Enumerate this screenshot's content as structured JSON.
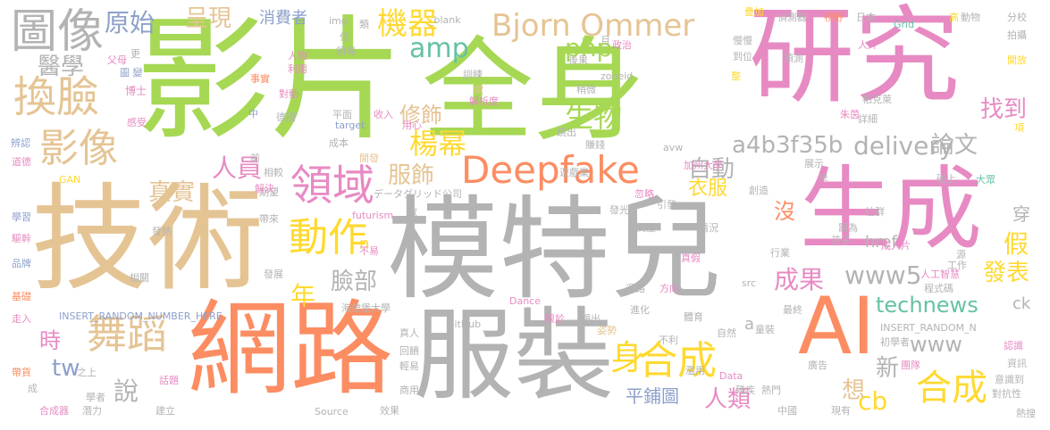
{
  "words": [
    {
      "text": "影片",
      "color": "#a6d854"
    },
    {
      "text": "全身",
      "color": "#a6d854"
    },
    {
      "text": "研究",
      "color": "#e78ac3"
    },
    {
      "text": "模特兒",
      "color": "#b3b3b3"
    },
    {
      "text": "技術",
      "color": "#e5c494"
    },
    {
      "text": "網路",
      "color": "#fc8d62"
    },
    {
      "text": "服裝",
      "color": "#b3b3b3"
    },
    {
      "text": "生成",
      "color": "#e78ac3"
    },
    {
      "text": "AI",
      "color": "#fc8d62"
    },
    {
      "text": "Deepfake",
      "color": "#fc8d62"
    },
    {
      "text": "Bjorn Ommer",
      "color": "#e5c494"
    },
    {
      "text": "圖像",
      "color": "#b3b3b3"
    },
    {
      "text": "換臉",
      "color": "#e5c494"
    },
    {
      "text": "影像",
      "color": "#e5c494"
    },
    {
      "text": "舞蹈",
      "color": "#e5c494"
    },
    {
      "text": "領域",
      "color": "#e78ac3"
    },
    {
      "text": "動作",
      "color": "#ffd92f"
    },
    {
      "text": "合成",
      "color": "#ffd92f"
    },
    {
      "text": "身",
      "color": "#ffd92f"
    },
    {
      "text": "合成",
      "color": "#ffd92f"
    },
    {
      "text": "technews",
      "color": "#66c2a5"
    },
    {
      "text": "delivery",
      "color": "#b3b3b3"
    },
    {
      "text": "www5",
      "color": "#b3b3b3"
    },
    {
      "text": "機器",
      "color": "#ffd92f"
    },
    {
      "text": "呈現",
      "color": "#e5c494"
    },
    {
      "text": "原始",
      "color": "#8da0cb"
    },
    {
      "text": "醫學",
      "color": "#b3b3b3"
    },
    {
      "text": "楊幂",
      "color": "#ffd92f"
    },
    {
      "text": "生物",
      "color": "#a6d854"
    },
    {
      "text": "amp",
      "color": "#66c2a5"
    },
    {
      "text": "php",
      "color": "#a6d854"
    },
    {
      "text": "修飾",
      "color": "#e5c494"
    },
    {
      "text": "a4b3f35b",
      "color": "#b3b3b3"
    },
    {
      "text": "自動",
      "color": "#b3b3b3"
    },
    {
      "text": "論文",
      "color": "#b3b3b3"
    },
    {
      "text": "找到",
      "color": "#e78ac3"
    },
    {
      "text": "人員",
      "color": "#e78ac3"
    },
    {
      "text": "真實",
      "color": "#e5c494"
    },
    {
      "text": "服飾",
      "color": "#e5c494"
    },
    {
      "text": "衣服",
      "color": "#ffd92f"
    },
    {
      "text": "成果",
      "color": "#e78ac3"
    },
    {
      "text": "發表",
      "color": "#ffd92f"
    },
    {
      "text": "年",
      "color": "#ffd92f"
    },
    {
      "text": "臉部",
      "color": "#b3b3b3"
    },
    {
      "text": "時",
      "color": "#e78ac3"
    },
    {
      "text": "說",
      "color": "#b3b3b3"
    },
    {
      "text": "人類",
      "color": "#e78ac3"
    },
    {
      "text": "平鋪圖",
      "color": "#8da0cb"
    },
    {
      "text": "cb",
      "color": "#ffd92f"
    },
    {
      "text": "www",
      "color": "#b3b3b3"
    },
    {
      "text": "新",
      "color": "#b3b3b3"
    },
    {
      "text": "想",
      "color": "#e5c494"
    },
    {
      "text": "tw",
      "color": "#8da0cb"
    },
    {
      "text": "消費者",
      "color": "#8da0cb"
    },
    {
      "text": "href",
      "color": "#b3b3b3"
    },
    {
      "text": "沒",
      "color": "#fc8d62"
    },
    {
      "text": "假",
      "color": "#ffd92f"
    },
    {
      "text": "穿",
      "color": "#b3b3b3"
    },
    {
      "text": "ck",
      "color": "#b3b3b3"
    },
    {
      "text": "n",
      "color": "#ffd92f"
    },
    {
      "text": "a",
      "color": "#b3b3b3"
    },
    {
      "text": "img",
      "color": "#b3b3b3"
    },
    {
      "text": "類",
      "color": "#b3b3b3"
    },
    {
      "text": "_blank",
      "color": "#b3b3b3"
    },
    {
      "text": "更",
      "color": "#b3b3b3"
    },
    {
      "text": "父母",
      "color": "#e78ac3"
    },
    {
      "text": "圖 變",
      "color": "#8da0cb"
    },
    {
      "text": "博士",
      "color": "#e78ac3"
    },
    {
      "text": "感受",
      "color": "#e78ac3"
    },
    {
      "text": "辨認",
      "color": "#8da0cb"
    },
    {
      "text": "人物",
      "color": "#e78ac3"
    },
    {
      "text": "利用",
      "color": "#e78ac3"
    },
    {
      "text": "低",
      "color": "#b3b3b3"
    },
    {
      "text": "領導",
      "color": "#b3b3b3"
    },
    {
      "text": "事實",
      "color": "#fc8d62"
    },
    {
      "text": "對動",
      "color": "#e78ac3"
    },
    {
      "text": "平面",
      "color": "#b3b3b3"
    },
    {
      "text": "收入",
      "color": "#e78ac3"
    },
    {
      "text": "解析度",
      "color": "#e78ac3"
    },
    {
      "text": "訓練",
      "color": "#b3b3b3"
    },
    {
      "text": "做",
      "color": "#e5c494"
    },
    {
      "text": "zoneid",
      "color": "#b3b3b3"
    },
    {
      "text": "後果",
      "color": "#b3b3b3"
    },
    {
      "text": "政治",
      "color": "#e78ac3"
    },
    {
      "text": "月",
      "color": "#b3b3b3"
    },
    {
      "text": "稍微",
      "color": "#b3b3b3"
    },
    {
      "text": "跳出",
      "color": "#b3b3b3"
    },
    {
      "text": "賺錢",
      "color": "#b3b3b3"
    },
    {
      "text": "avw",
      "color": "#b3b3b3"
    },
    {
      "text": "加州大學",
      "color": "#e78ac3"
    },
    {
      "text": "疊加",
      "color": "#ffd92f"
    },
    {
      "text": "偵測器",
      "color": "#b3b3b3"
    },
    {
      "text": "視野",
      "color": "#fc8d62"
    },
    {
      "text": "日本",
      "color": "#b3b3b3"
    },
    {
      "text": "Grid",
      "color": "#66c2a5"
    },
    {
      "text": "高",
      "color": "#ffd92f"
    },
    {
      "text": "動物",
      "color": "#b3b3b3"
    },
    {
      "text": "分校",
      "color": "#b3b3b3"
    },
    {
      "text": "拍攝",
      "color": "#b3b3b3"
    },
    {
      "text": "慢慢",
      "color": "#b3b3b3"
    },
    {
      "text": "到位",
      "color": "#b3b3b3"
    },
    {
      "text": "預測",
      "color": "#b3b3b3"
    },
    {
      "text": "人片",
      "color": "#e78ac3"
    },
    {
      "text": "開放",
      "color": "#ffd92f"
    },
    {
      "text": "柏克萊",
      "color": "#b3b3b3"
    },
    {
      "text": "朱茵",
      "color": "#e78ac3"
    },
    {
      "text": "詳細",
      "color": "#b3b3b3"
    },
    {
      "text": "項",
      "color": "#ffd92f"
    },
    {
      "text": "整",
      "color": "#ffd92f"
    },
    {
      "text": "target",
      "color": "#8da0cb"
    },
    {
      "text": "中",
      "color": "#8da0cb"
    },
    {
      "text": "德國",
      "color": "#b3b3b3"
    },
    {
      "text": "成本",
      "color": "#b3b3b3"
    },
    {
      "text": "用心",
      "color": "#e78ac3"
    },
    {
      "text": "前",
      "color": "#b3b3b3"
    },
    {
      "text": "道德",
      "color": "#e78ac3"
    },
    {
      "text": "GAN",
      "color": "#ffd92f"
    },
    {
      "text": "學習",
      "color": "#8da0cb"
    },
    {
      "text": "驅幹",
      "color": "#e78ac3"
    },
    {
      "text": "品牌",
      "color": "#8da0cb"
    },
    {
      "text": "基礎",
      "color": "#fc8d62"
    },
    {
      "text": "走入",
      "color": "#e78ac3"
    },
    {
      "text": "帶貨",
      "color": "#fc8d62"
    },
    {
      "text": "成",
      "color": "#b3b3b3"
    },
    {
      "text": "合成器",
      "color": "#e78ac3"
    },
    {
      "text": "開發",
      "color": "#e5c494"
    },
    {
      "text": "相較",
      "color": "#b3b3b3"
    },
    {
      "text": "期望",
      "color": "#b3b3b3"
    },
    {
      "text": "解決",
      "color": "#e78ac3"
    },
    {
      "text": "データグリッド公司",
      "color": "#b3b3b3"
    },
    {
      "text": "futurism",
      "color": "#e78ac3"
    },
    {
      "text": "帶來",
      "color": "#b3b3b3"
    },
    {
      "text": "發熱",
      "color": "#b3b3b3"
    },
    {
      "text": "發展",
      "color": "#b3b3b3"
    },
    {
      "text": "相關",
      "color": "#b3b3b3"
    },
    {
      "text": "海德堡大學",
      "color": "#b3b3b3"
    },
    {
      "text": "INSERT_RANDOM_NUMBER_HERE",
      "color": "#8da0cb"
    },
    {
      "text": "不易",
      "color": "#e78ac3"
    },
    {
      "text": "教",
      "color": "#b3b3b3"
    },
    {
      "text": "遊戲業",
      "color": "#b3b3b3"
    },
    {
      "text": "忽略",
      "color": "#e78ac3"
    },
    {
      "text": "發光",
      "color": "#b3b3b3"
    },
    {
      "text": "引發",
      "color": "#b3b3b3"
    },
    {
      "text": "創造",
      "color": "#b3b3b3"
    },
    {
      "text": "展示",
      "color": "#b3b3b3"
    },
    {
      "text": "早",
      "color": "#b3b3b3"
    },
    {
      "text": "碰上",
      "color": "#b3b3b3"
    },
    {
      "text": "大眾",
      "color": "#66c2a5"
    },
    {
      "text": "社群",
      "color": "#b3b3b3"
    },
    {
      "text": "題為",
      "color": "#b3b3b3"
    },
    {
      "text": "情況",
      "color": "#b3b3b3"
    },
    {
      "text": "高度",
      "color": "#b3b3b3"
    },
    {
      "text": "孩子",
      "color": "#b3b3b3"
    },
    {
      "text": "真假",
      "color": "#e78ac3"
    },
    {
      "text": "行業",
      "color": "#b3b3b3"
    },
    {
      "text": "成人片",
      "color": "#e78ac3"
    },
    {
      "text": "源",
      "color": "#b3b3b3"
    },
    {
      "text": "工作",
      "color": "#b3b3b3"
    },
    {
      "text": "人工智慧",
      "color": "#e78ac3"
    },
    {
      "text": "程式碼",
      "color": "#b3b3b3"
    },
    {
      "text": "迴路",
      "color": "#b3b3b3"
    },
    {
      "text": "方向",
      "color": "#e78ac3"
    },
    {
      "text": "src",
      "color": "#b3b3b3"
    },
    {
      "text": "最終",
      "color": "#b3b3b3"
    },
    {
      "text": "Dance",
      "color": "#e78ac3"
    },
    {
      "text": "限於",
      "color": "#e78ac3"
    },
    {
      "text": "顯出",
      "color": "#b3b3b3"
    },
    {
      "text": "進化",
      "color": "#b3b3b3"
    },
    {
      "text": "體育",
      "color": "#b3b3b3"
    },
    {
      "text": "GitHub",
      "color": "#b3b3b3"
    },
    {
      "text": "真人",
      "color": "#b3b3b3"
    },
    {
      "text": "回饋",
      "color": "#b3b3b3"
    },
    {
      "text": "輕易",
      "color": "#b3b3b3"
    },
    {
      "text": "姿勢",
      "color": "#e5c494"
    },
    {
      "text": "不利",
      "color": "#b3b3b3"
    },
    {
      "text": "自然",
      "color": "#b3b3b3"
    },
    {
      "text": "童裝",
      "color": "#b3b3b3"
    },
    {
      "text": "INSERT_RANDOM_N",
      "color": "#b3b3b3"
    },
    {
      "text": "初學者",
      "color": "#b3b3b3"
    },
    {
      "text": "認識",
      "color": "#e78ac3"
    },
    {
      "text": "資訊",
      "color": "#b3b3b3"
    },
    {
      "text": "意識到",
      "color": "#b3b3b3"
    },
    {
      "text": "對抗性",
      "color": "#b3b3b3"
    },
    {
      "text": "熱搜",
      "color": "#b3b3b3"
    },
    {
      "text": "團隊",
      "color": "#e78ac3"
    },
    {
      "text": "廣告",
      "color": "#b3b3b3"
    },
    {
      "text": "之上",
      "color": "#b3b3b3"
    },
    {
      "text": "學者",
      "color": "#b3b3b3"
    },
    {
      "text": "潛力",
      "color": "#b3b3b3"
    },
    {
      "text": "話題",
      "color": "#e78ac3"
    },
    {
      "text": "建立",
      "color": "#b3b3b3"
    },
    {
      "text": "Source",
      "color": "#b3b3b3"
    },
    {
      "text": "效果",
      "color": "#b3b3b3"
    },
    {
      "text": "商用",
      "color": "#b3b3b3"
    },
    {
      "text": "Data",
      "color": "#e78ac3"
    },
    {
      "text": "殘疾",
      "color": "#b3b3b3"
    },
    {
      "text": "熱門",
      "color": "#b3b3b3"
    },
    {
      "text": "濫用",
      "color": "#b3b3b3"
    },
    {
      "text": "中國",
      "color": "#b3b3b3"
    },
    {
      "text": "現有",
      "color": "#b3b3b3"
    }
  ]
}
